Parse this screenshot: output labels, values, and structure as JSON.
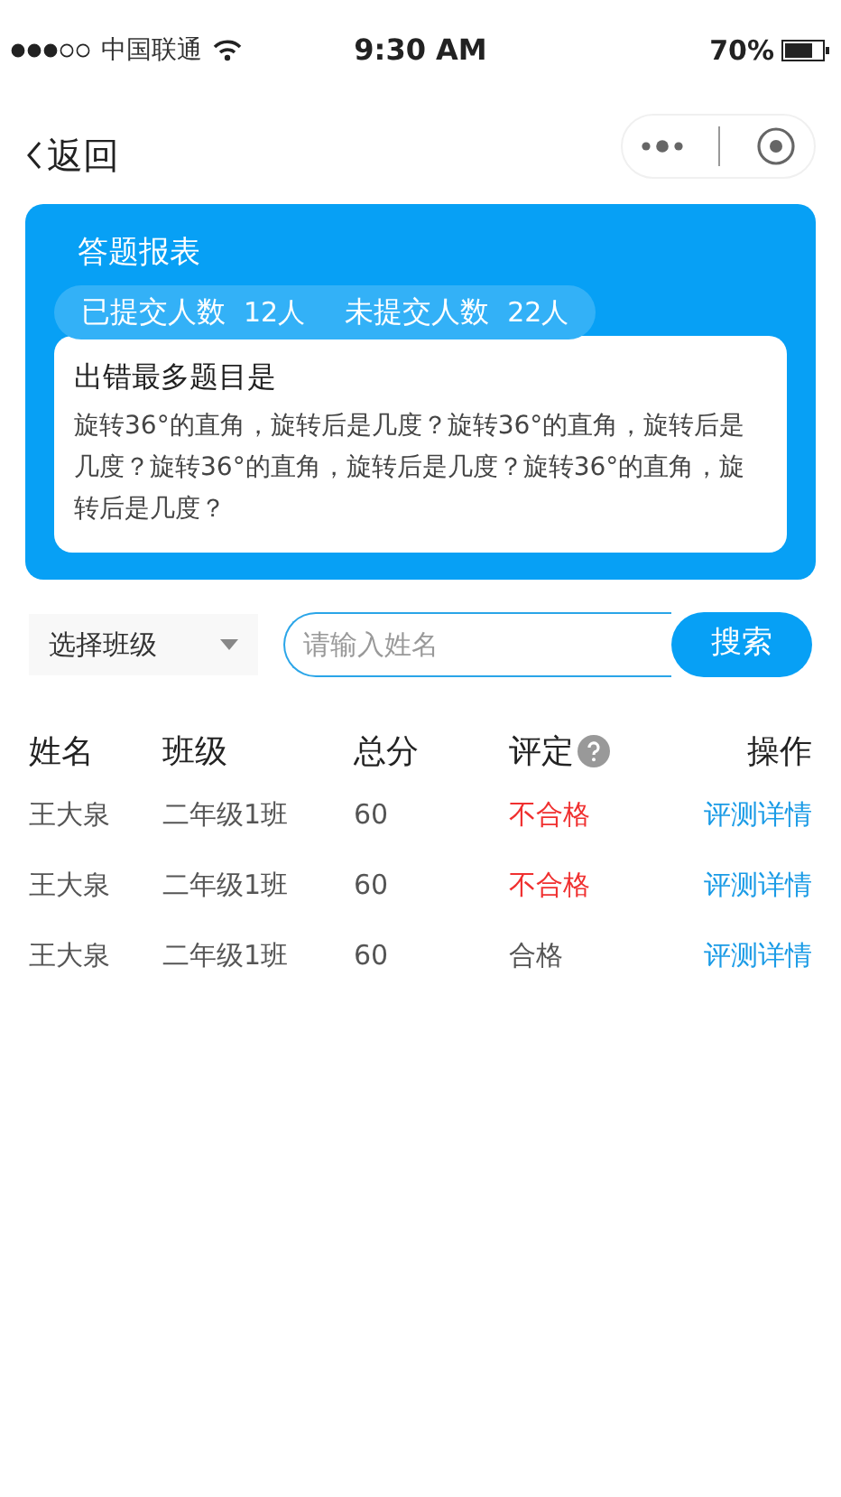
{
  "status_bar": {
    "carrier": "中国联通",
    "time": "9:30 AM",
    "battery": "70%"
  },
  "nav": {
    "back": "返回"
  },
  "report": {
    "title": "答题报表",
    "stats": [
      {
        "label": "已提交人数",
        "value": "12人"
      },
      {
        "label": "未提交人数",
        "value": "22人"
      }
    ],
    "question_title": "出错最多题目是",
    "question_text": "旋转36°的直角，旋转后是几度？旋转36°的直角，旋转后是几度？旋转36°的直角，旋转后是几度？旋转36°的直角，旋转后是几度？"
  },
  "filter": {
    "class_select": "选择班级",
    "search": {
      "placeholder": "请输入姓名"
    },
    "search_button": "搜索"
  },
  "table": {
    "columns": [
      "姓名",
      "班级",
      "总分",
      "评定",
      "操作"
    ],
    "rows": [
      {
        "name": "王大泉",
        "class": "二年级1班",
        "score": "60",
        "rating": "不合格",
        "passed": false,
        "action": "评测详情"
      },
      {
        "name": "王大泉",
        "class": "二年级1班",
        "score": "60",
        "rating": "不合格",
        "passed": false,
        "action": "评测详情"
      },
      {
        "name": "王大泉",
        "class": "二年级1班",
        "score": "60",
        "rating": "合格",
        "passed": true,
        "action": "评测详情"
      }
    ]
  }
}
